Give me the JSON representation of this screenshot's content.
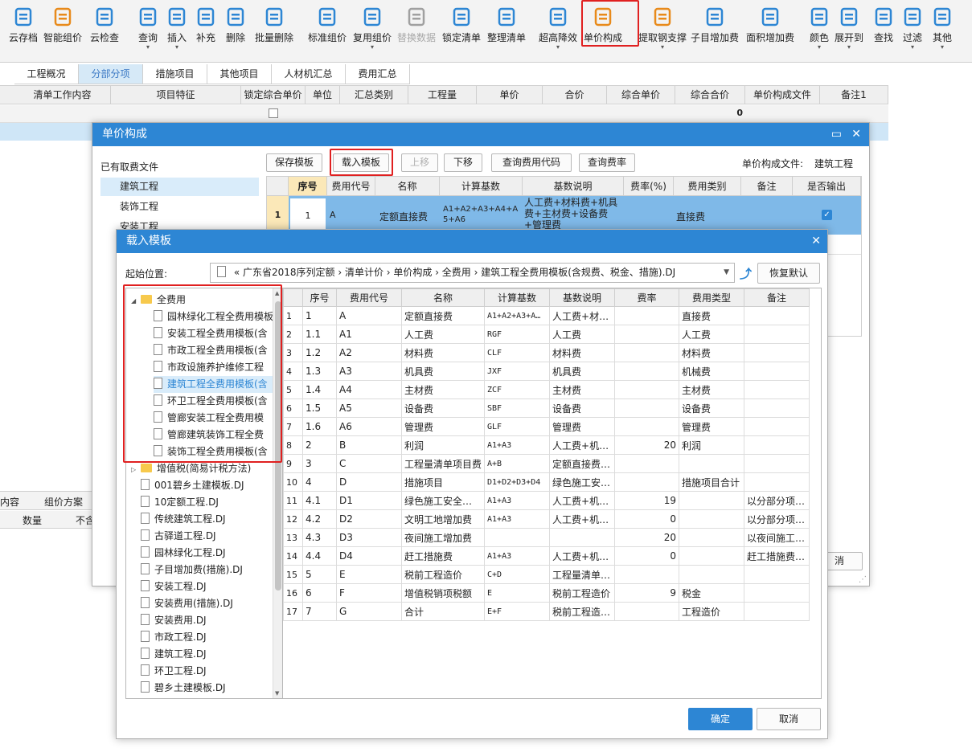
{
  "toolbar": {
    "items": [
      {
        "label": "云存档",
        "icon": "cloud-save-icon"
      },
      {
        "label": "智能组价",
        "icon": "smart-price-icon"
      },
      {
        "label": "云检查",
        "icon": "cloud-check-icon"
      },
      {
        "label": "查询",
        "icon": "query-icon"
      },
      {
        "label": "插入",
        "icon": "insert-icon"
      },
      {
        "label": "补充",
        "icon": "supplement-icon"
      },
      {
        "label": "删除",
        "icon": "delete-icon"
      },
      {
        "label": "批量删除",
        "icon": "batch-delete-icon"
      },
      {
        "label": "标准组价",
        "icon": "standard-price-icon"
      },
      {
        "label": "复用组价",
        "icon": "reuse-price-icon"
      },
      {
        "label": "替换数据",
        "icon": "replace-data-icon"
      },
      {
        "label": "锁定清单",
        "icon": "lock-list-icon"
      },
      {
        "label": "整理清单",
        "icon": "organize-list-icon"
      },
      {
        "label": "超高降效",
        "icon": "height-efficiency-icon"
      },
      {
        "label": "单价构成",
        "icon": "unit-price-icon"
      },
      {
        "label": "提取钢支撑",
        "icon": "steel-support-icon"
      },
      {
        "label": "子目增加费",
        "icon": "sub-item-fee-icon"
      },
      {
        "label": "面积增加费",
        "icon": "area-fee-icon"
      },
      {
        "label": "颜色",
        "icon": "color-icon"
      },
      {
        "label": "展开到",
        "icon": "expand-icon"
      },
      {
        "label": "查找",
        "icon": "find-icon"
      },
      {
        "label": "过滤",
        "icon": "filter-icon"
      },
      {
        "label": "其他",
        "icon": "other-icon"
      }
    ],
    "highlight_color": "#e02020"
  },
  "tabs": [
    "工程概况",
    "分部分项",
    "措施项目",
    "其他项目",
    "人材机汇总",
    "费用汇总"
  ],
  "main_grid": {
    "headers": [
      "清单工作内容",
      "项目特征",
      "锁定综合单价",
      "单位",
      "汇总类别",
      "工程量",
      "单价",
      "合价",
      "综合单价",
      "综合合价",
      "单价构成文件",
      "备注1"
    ],
    "row1_total": "0"
  },
  "bottom_panel": {
    "tabs": [
      "内容",
      "组价方案"
    ],
    "headers": [
      "数量",
      "不含"
    ]
  },
  "dialog1": {
    "title": "单价构成",
    "left_label": "已有取费文件",
    "fee_files": [
      "建筑工程",
      "装饰工程",
      "安装工程"
    ],
    "buttons": {
      "save": "保存模板",
      "load": "载入模板",
      "up": "上移",
      "down": "下移",
      "query_code": "查询费用代码",
      "query_rate": "查询费率"
    },
    "file_label": "单价构成文件:",
    "file_value": "建筑工程",
    "headers": [
      "序号",
      "费用代号",
      "名称",
      "计算基数",
      "基数说明",
      "费率(%)",
      "费用类别",
      "备注",
      "是否输出"
    ],
    "row": {
      "index": "1",
      "seq": "1",
      "code": "A",
      "name": "定额直接费",
      "base": "A1+A2+A3+A4+A5+A6",
      "desc": "人工费+材料费+机具费+主材费+设备费+管理费",
      "category": "直接费"
    },
    "cancel_partial": "消"
  },
  "dialog2": {
    "title": "载入模板",
    "start_label": "起始位置:",
    "path": "« 广东省2018序列定额 › 清单计价 › 单价构成 › 全费用 › 建筑工程全费用模板(含规费、税金、措施).DJ",
    "restore_button": "恢复默认",
    "tree": [
      {
        "label": "全费用",
        "type": "folder",
        "expanded": true
      },
      {
        "label": "园林绿化工程全费用模板",
        "type": "file",
        "child": true
      },
      {
        "label": "安装工程全费用模板(含",
        "type": "file",
        "child": true
      },
      {
        "label": "市政工程全费用模板(含",
        "type": "file",
        "child": true
      },
      {
        "label": "市政设施养护维修工程",
        "type": "file",
        "child": true
      },
      {
        "label": "建筑工程全费用模板(含",
        "type": "file",
        "child": true,
        "selected": true
      },
      {
        "label": "环卫工程全费用模板(含",
        "type": "file",
        "child": true
      },
      {
        "label": "管廊安装工程全费用模",
        "type": "file",
        "child": true
      },
      {
        "label": "管廊建筑装饰工程全费",
        "type": "file",
        "child": true
      },
      {
        "label": "装饰工程全费用模板(含",
        "type": "file",
        "child": true
      },
      {
        "label": "增值税(简易计税方法)",
        "type": "folder",
        "expanded": false
      },
      {
        "label": "001碧乡土建模板.DJ",
        "type": "file"
      },
      {
        "label": "10定额工程.DJ",
        "type": "file"
      },
      {
        "label": "传统建筑工程.DJ",
        "type": "file"
      },
      {
        "label": "古驿道工程.DJ",
        "type": "file"
      },
      {
        "label": "园林绿化工程.DJ",
        "type": "file"
      },
      {
        "label": "子目增加费(措施).DJ",
        "type": "file"
      },
      {
        "label": "安装工程.DJ",
        "type": "file"
      },
      {
        "label": "安装费用(措施).DJ",
        "type": "file"
      },
      {
        "label": "安装费用.DJ",
        "type": "file"
      },
      {
        "label": "市政工程.DJ",
        "type": "file"
      },
      {
        "label": "建筑工程.DJ",
        "type": "file"
      },
      {
        "label": "环卫工程.DJ",
        "type": "file"
      },
      {
        "label": "碧乡土建模板.DJ",
        "type": "file"
      }
    ],
    "headers": [
      "",
      "序号",
      "费用代号",
      "名称",
      "计算基数",
      "基数说明",
      "费率",
      "费用类型",
      "备注"
    ],
    "rows": [
      [
        "1",
        "1",
        "A",
        "定额直接费",
        "A1+A2+A3+A…",
        "人工费+材…",
        "",
        "直接费",
        ""
      ],
      [
        "2",
        "1.1",
        "A1",
        "人工费",
        "RGF",
        "人工费",
        "",
        "人工费",
        ""
      ],
      [
        "3",
        "1.2",
        "A2",
        "材料费",
        "CLF",
        "材料费",
        "",
        "材料费",
        ""
      ],
      [
        "4",
        "1.3",
        "A3",
        "机具费",
        "JXF",
        "机具费",
        "",
        "机械费",
        ""
      ],
      [
        "5",
        "1.4",
        "A4",
        "主材费",
        "ZCF",
        "主材费",
        "",
        "主材费",
        ""
      ],
      [
        "6",
        "1.5",
        "A5",
        "设备费",
        "SBF",
        "设备费",
        "",
        "设备费",
        ""
      ],
      [
        "7",
        "1.6",
        "A6",
        "管理费",
        "GLF",
        "管理费",
        "",
        "管理费",
        ""
      ],
      [
        "8",
        "2",
        "B",
        "利润",
        "A1+A3",
        "人工费+机…",
        "20",
        "利润",
        ""
      ],
      [
        "9",
        "3",
        "C",
        "工程量清单项目费",
        "A+B",
        "定额直接费…",
        "",
        "",
        ""
      ],
      [
        "10",
        "4",
        "D",
        "措施项目",
        "D1+D2+D3+D4",
        "绿色施工安…",
        "",
        "措施项目合计",
        ""
      ],
      [
        "11",
        "4.1",
        "D1",
        "绿色施工安全…",
        "A1+A3",
        "人工费+机…",
        "19",
        "",
        "以分部分项…"
      ],
      [
        "12",
        "4.2",
        "D2",
        "文明工地增加费",
        "A1+A3",
        "人工费+机…",
        "0",
        "",
        "以分部分项…"
      ],
      [
        "13",
        "4.3",
        "D3",
        "夜间施工增加费",
        "",
        "",
        "20",
        "",
        "以夜间施工…"
      ],
      [
        "14",
        "4.4",
        "D4",
        "赶工措施费",
        "A1+A3",
        "人工费+机…",
        "0",
        "",
        "赶工措施费…"
      ],
      [
        "15",
        "5",
        "E",
        "税前工程造价",
        "C+D",
        "工程量清单…",
        "",
        "",
        ""
      ],
      [
        "16",
        "6",
        "F",
        "增值税销项税额",
        "E",
        "税前工程造价",
        "9",
        "税金",
        ""
      ],
      [
        "17",
        "7",
        "G",
        "合计",
        "E+F",
        "税前工程造…",
        "",
        "工程造价",
        ""
      ]
    ],
    "ok_button": "确定",
    "cancel_button": "取消"
  }
}
